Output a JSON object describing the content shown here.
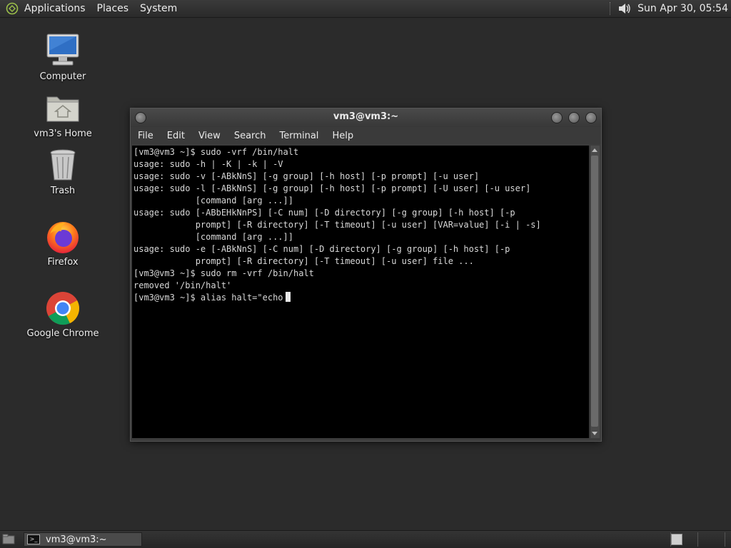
{
  "top_panel": {
    "menus": [
      "Applications",
      "Places",
      "System"
    ],
    "clock": "Sun Apr 30, 05:54"
  },
  "desktop_icons": [
    {
      "label": "Computer",
      "icon": "computer-icon"
    },
    {
      "label": "vm3's Home",
      "icon": "home-folder-icon"
    },
    {
      "label": "Trash",
      "icon": "trash-icon"
    },
    {
      "label": "Firefox",
      "icon": "firefox-icon"
    },
    {
      "label": "Google Chrome",
      "icon": "chrome-icon"
    }
  ],
  "terminal": {
    "title": "vm3@vm3:~",
    "menus": [
      "File",
      "Edit",
      "View",
      "Search",
      "Terminal",
      "Help"
    ],
    "lines": [
      "[vm3@vm3 ~]$ sudo -vrf /bin/halt",
      "usage: sudo -h | -K | -k | -V",
      "usage: sudo -v [-ABkNnS] [-g group] [-h host] [-p prompt] [-u user]",
      "usage: sudo -l [-ABkNnS] [-g group] [-h host] [-p prompt] [-U user] [-u user]",
      "            [command [arg ...]]",
      "usage: sudo [-ABbEHkNnPS] [-C num] [-D directory] [-g group] [-h host] [-p",
      "            prompt] [-R directory] [-T timeout] [-u user] [VAR=value] [-i | -s]",
      "            [command [arg ...]]",
      "usage: sudo -e [-ABkNnS] [-C num] [-D directory] [-g group] [-h host] [-p",
      "            prompt] [-R directory] [-T timeout] [-u user] file ...",
      "[vm3@vm3 ~]$ sudo rm -vrf /bin/halt",
      "removed '/bin/halt'"
    ],
    "prompt_line": "[vm3@vm3 ~]$ alias halt=\"echo"
  },
  "taskbar": {
    "window_button": "vm3@vm3:~"
  },
  "colors": {
    "desktop": "#2b2b2b",
    "terminal_bg": "#000000",
    "terminal_fg": "#d8d8d8"
  }
}
